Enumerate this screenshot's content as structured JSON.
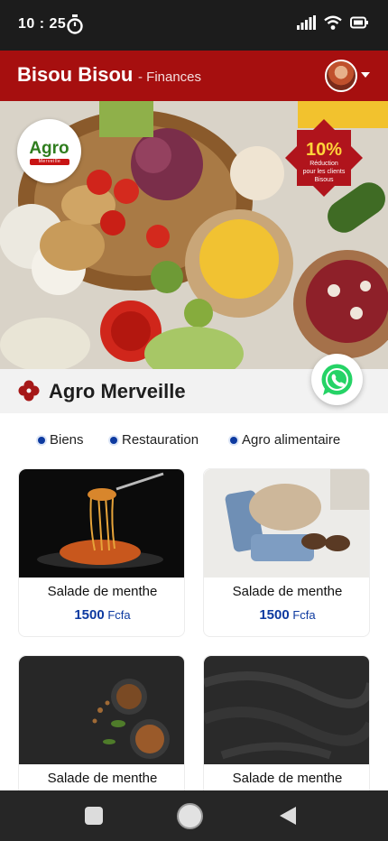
{
  "status_bar": {
    "time": "10 : 25"
  },
  "header": {
    "title": "Bisou Bisou",
    "subtitle": "- Finances"
  },
  "hero": {
    "logo_text": "Agro",
    "logo_band": "Merveille",
    "promo_percent": "10%",
    "promo_line1": "Réduction",
    "promo_line2": "pour les clients",
    "promo_line3": "Bisous"
  },
  "store": {
    "name": "Agro Merveille"
  },
  "categories": [
    {
      "label": "Biens"
    },
    {
      "label": "Restauration"
    },
    {
      "label": "Agro alimentaire"
    }
  ],
  "products": [
    {
      "title": "Salade de menthe",
      "price": "1500",
      "currency": "Fcfa",
      "image": "spaghetti-fork"
    },
    {
      "title": "Salade de menthe",
      "price": "1500",
      "currency": "Fcfa",
      "image": "clothes-shoes"
    },
    {
      "title": "Salade de menthe",
      "price": "",
      "currency": "",
      "image": "spices-bowls"
    },
    {
      "title": "Salade de menthe",
      "price": "",
      "currency": "",
      "image": "dark-fabric"
    }
  ],
  "colors": {
    "header": "#a60f0f",
    "accent": "#0d3aa0",
    "status_bar": "#1c1c1c",
    "nav_bar": "#262626"
  }
}
